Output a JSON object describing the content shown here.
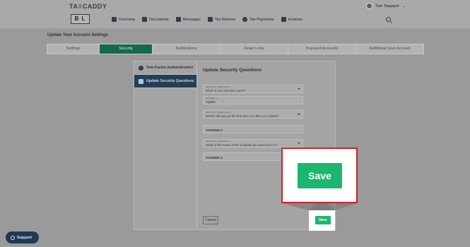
{
  "header": {
    "logo_text_a": "TA",
    "logo_text_x": "X",
    "logo_text_b": "CADDY",
    "firm_logo": "B L",
    "user_name": "Tom Taxpayer",
    "user_caret": "⌄",
    "nav": [
      {
        "label": "Overview",
        "icon": "home-icon"
      },
      {
        "label": "Documents",
        "icon": "documents-icon"
      },
      {
        "label": "Messages",
        "icon": "messages-icon"
      },
      {
        "label": "Tax Returns",
        "icon": "tax-returns-icon"
      },
      {
        "label": "Tax Payments",
        "icon": "tax-payments-icon"
      },
      {
        "label": "Invoices",
        "icon": "invoices-icon"
      }
    ]
  },
  "page": {
    "title": "Update Your Account Settings"
  },
  "tabs": [
    {
      "label": "Settings"
    },
    {
      "label": "Security"
    },
    {
      "label": "Notifications"
    },
    {
      "label": "Smart Links"
    },
    {
      "label": "Payment Accounts"
    },
    {
      "label": "Additional User Account"
    }
  ],
  "sidenav": [
    {
      "label": "Two-Factor Authentication",
      "icon": "shield-icon"
    },
    {
      "label": "Update Security Questions",
      "icon": "chat-icon"
    }
  ],
  "form": {
    "title": "Update Security Questions",
    "q1_label": "SECURITY QUESTION 1",
    "q1_value": "What is your favorite snack?",
    "a1_label": "ANSWER 1",
    "a1_value": "Apples",
    "q2_label": "SECURITY QUESTION 2",
    "q2_value": "Where did you go the first time you flew on a plane?",
    "a2_placeholder": "ANSWER 2",
    "q3_label": "SECURITY QUESTION 3",
    "q3_value": "What is the name of the hospital you were born in?",
    "a3_placeholder": "ANSWER 3",
    "cancel_label": "Cancel",
    "save_label": "Save"
  },
  "callout": {
    "save_label": "Save",
    "border_color": "#d41f26",
    "button_color": "#1cb66f"
  },
  "support": {
    "label": "Support"
  }
}
